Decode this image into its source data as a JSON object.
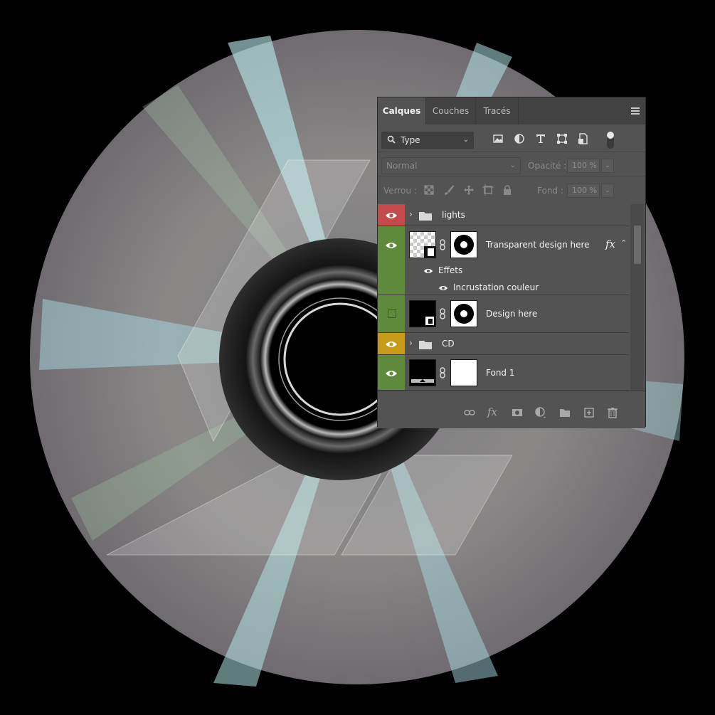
{
  "panel": {
    "tabs": [
      {
        "label": "Calques",
        "active": true
      },
      {
        "label": "Couches",
        "active": false
      },
      {
        "label": "Tracés",
        "active": false
      }
    ],
    "filter": {
      "value": "Type"
    },
    "blend_mode": "Normal",
    "opacity": {
      "label": "Opacité :",
      "value": "100 %"
    },
    "lock": {
      "label": "Verrou :"
    },
    "fill": {
      "label": "Fond :",
      "value": "100 %"
    },
    "layers": [
      {
        "name": "lights",
        "type": "group",
        "color": "#c54a4b",
        "visible": true
      },
      {
        "name": "Transparent design here",
        "type": "layer",
        "color": "#5f8a3b",
        "visible": true,
        "fx": "fx",
        "effects_label": "Effets",
        "effect": "Incrustation couleur"
      },
      {
        "name": "Design here",
        "type": "layer",
        "color": "#5f8a3b",
        "visible": false
      },
      {
        "name": "CD",
        "type": "group",
        "color": "#c79b18",
        "visible": true
      },
      {
        "name": "Fond 1",
        "type": "layer",
        "color": "#5f8a3b",
        "visible": true
      }
    ]
  },
  "icons": {
    "menu": "panel-menu-icon",
    "filter_search": "search-icon",
    "image_filter": "image-filter-icon",
    "adjustment_filter": "adjustment-filter-icon",
    "type_filter": "type-filter-icon",
    "shape_filter": "shape-filter-icon",
    "smart_object_filter": "smart-object-filter-icon",
    "filter_toggle": "filter-toggle-icon",
    "bottom": [
      "link-layers-icon",
      "fx-icon",
      "mask-icon",
      "adjustment-layer-icon",
      "new-group-icon",
      "new-layer-icon",
      "trash-icon"
    ]
  }
}
